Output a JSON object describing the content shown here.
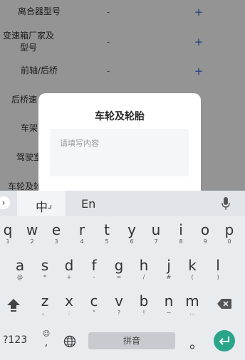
{
  "form": {
    "rows": [
      {
        "label": "离合器型号",
        "value": "-",
        "action": "+"
      },
      {
        "label": "变速箱厂家及型号",
        "value": "-",
        "action": "+"
      },
      {
        "label": "前轴/后桥",
        "value": "-",
        "action": "+"
      },
      {
        "label": "后桥速"
      },
      {
        "label": "车架"
      },
      {
        "label": "驾驶室"
      },
      {
        "label": "车轮及轮"
      }
    ]
  },
  "dialog": {
    "title": "车轮及轮胎",
    "placeholder": "请填写内容"
  },
  "keyboard": {
    "tab_chinese": "中",
    "tab_english": "En",
    "row1": [
      {
        "ch": "q",
        "sub": "1"
      },
      {
        "ch": "w",
        "sub": "2"
      },
      {
        "ch": "e",
        "sub": "3"
      },
      {
        "ch": "r",
        "sub": "4"
      },
      {
        "ch": "t",
        "sub": "5"
      },
      {
        "ch": "y",
        "sub": "6"
      },
      {
        "ch": "u",
        "sub": "7"
      },
      {
        "ch": "i",
        "sub": "8"
      },
      {
        "ch": "o",
        "sub": "9"
      },
      {
        "ch": "p",
        "sub": "0"
      }
    ],
    "row2": [
      {
        "ch": "a",
        "sub": "@"
      },
      {
        "ch": "s",
        "sub": "*"
      },
      {
        "ch": "d",
        "sub": "+"
      },
      {
        "ch": "f",
        "sub": "-"
      },
      {
        "ch": "g",
        "sub": "="
      },
      {
        "ch": "h",
        "sub": "/"
      },
      {
        "ch": "j",
        "sub": "#"
      },
      {
        "ch": "k",
        "sub": "("
      },
      {
        "ch": "l",
        "sub": ")"
      }
    ],
    "row3": [
      {
        "ch": "z",
        "sub": "、"
      },
      {
        "ch": "x",
        "sub": ":"
      },
      {
        "ch": "c",
        "sub": "\""
      },
      {
        "ch": "v",
        "sub": "?"
      },
      {
        "ch": "b",
        "sub": "!"
      },
      {
        "ch": "n",
        "sub": "~"
      },
      {
        "ch": "m",
        "sub": "…"
      }
    ],
    "numbers_label": "?123",
    "comma_label": ",",
    "space_label": "拼音",
    "period_label": "。",
    "icons": [
      "chevron-right-icon",
      "microphone-icon",
      "shift-icon",
      "backspace-icon",
      "emoji-icon",
      "globe-icon",
      "enter-icon"
    ]
  }
}
